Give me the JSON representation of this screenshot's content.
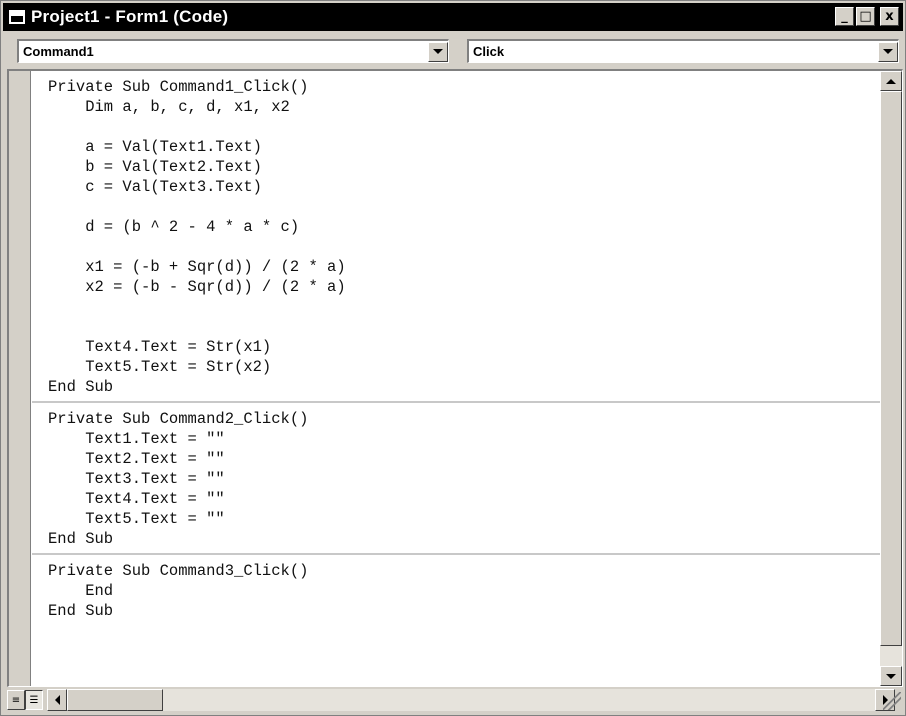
{
  "window": {
    "title": "Project1 - Form1 (Code)",
    "buttons": {
      "minimize": "_",
      "maximize": "□",
      "close": "x"
    }
  },
  "object_combo": {
    "value": "Command1"
  },
  "procedure_combo": {
    "value": "Click"
  },
  "code": {
    "procedures": [
      {
        "lines": [
          "Private Sub Command1_Click()",
          "    Dim a, b, c, d, x1, x2",
          "",
          "    a = Val(Text1.Text)",
          "    b = Val(Text2.Text)",
          "    c = Val(Text3.Text)",
          "",
          "    d = (b ^ 2 - 4 * a * c)",
          "",
          "    x1 = (-b + Sqr(d)) / (2 * a)",
          "    x2 = (-b - Sqr(d)) / (2 * a)",
          "",
          "",
          "    Text4.Text = Str(x1)",
          "    Text5.Text = Str(x2)",
          "End Sub"
        ]
      },
      {
        "lines": [
          "Private Sub Command2_Click()",
          "    Text1.Text = \"\"",
          "    Text2.Text = \"\"",
          "    Text3.Text = \"\"",
          "    Text4.Text = \"\"",
          "    Text5.Text = \"\"",
          "End Sub"
        ]
      },
      {
        "lines": [
          "Private Sub Command3_Click()",
          "    End",
          "End Sub"
        ]
      }
    ]
  },
  "bottom": {
    "procedure_view_icon": "procedure-view-icon",
    "full_module_view_icon": "full-module-view-icon"
  }
}
